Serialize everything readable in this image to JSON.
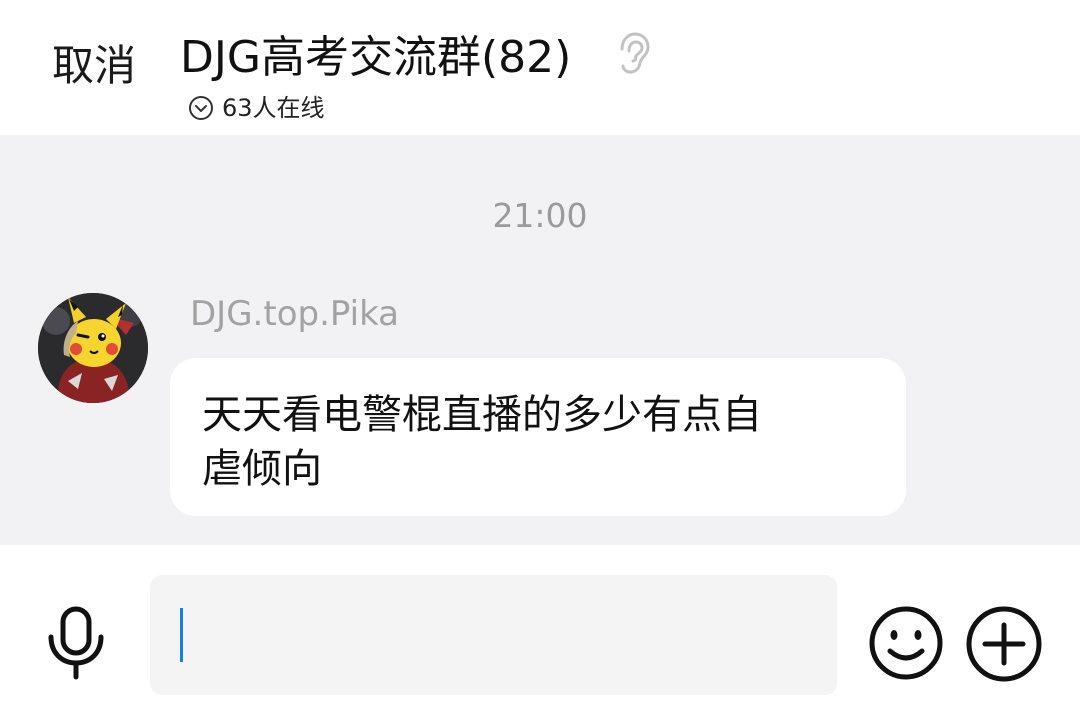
{
  "header": {
    "cancel_label": "取消",
    "title": "DJG高考交流群(82)",
    "online_text": "63人在线"
  },
  "chat": {
    "timestamp": "21:00",
    "messages": [
      {
        "sender": "DJG.top.Pika",
        "line1": "天天看电警棍直播的多少有点自",
        "line2": "虐倾向"
      }
    ]
  },
  "input": {
    "value": "",
    "placeholder": ""
  },
  "colors": {
    "chat_background": "#f2f2f4",
    "caret": "#1a7fe0",
    "meta_text": "#9a9a9a"
  },
  "icons": {
    "ear": "ear-icon",
    "online_toggle": "chevron-down-circle-icon",
    "voice": "microphone-icon",
    "emoji": "smiley-icon",
    "more": "plus-circle-icon"
  }
}
